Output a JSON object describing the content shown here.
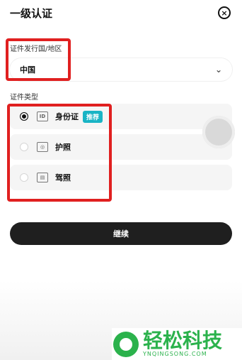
{
  "header": {
    "title": "一级认证",
    "close_icon": "close-icon"
  },
  "country": {
    "label": "证件发行国/地区",
    "value": "中国",
    "chevron_icon": "chevron-down-icon"
  },
  "id_type": {
    "label": "证件类型",
    "options": [
      {
        "label": "身份证",
        "selected": true,
        "icon": "id-card-icon",
        "icon_glyph": "ID",
        "badge": "推荐"
      },
      {
        "label": "护照",
        "selected": false,
        "icon": "passport-icon",
        "icon_glyph": "◎"
      },
      {
        "label": "驾照",
        "selected": false,
        "icon": "driver-license-icon",
        "icon_glyph": "▤"
      }
    ]
  },
  "actions": {
    "continue_label": "继续"
  },
  "watermark": {
    "brand": "轻松科技",
    "site": "YNQINGSONG.COM"
  },
  "colors": {
    "annotation": "#e02020",
    "badge": "#19b4c5",
    "button": "#1f1f1f",
    "watermark": "#2bb24c"
  }
}
